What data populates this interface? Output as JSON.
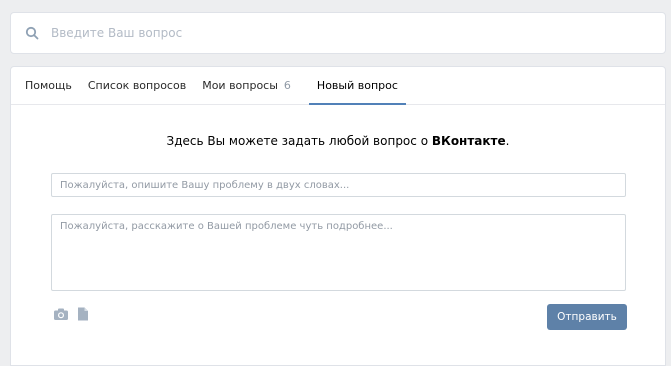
{
  "search": {
    "placeholder": "Введите Ваш вопрос",
    "icon": "search-icon"
  },
  "tabs": [
    {
      "label": "Помощь",
      "count": "",
      "active": false
    },
    {
      "label": "Список вопросов",
      "count": "",
      "active": false
    },
    {
      "label": "Мои вопросы",
      "count": "6",
      "active": false
    },
    {
      "label": "Новый вопрос",
      "count": "",
      "active": true
    }
  ],
  "intro": {
    "text": "Здесь Вы можете задать любой вопрос о ",
    "brand": "ВКонтакте",
    "suffix": "."
  },
  "form": {
    "subject_placeholder": "Пожалуйста, опишите Вашу проблему в двух словах...",
    "details_placeholder": "Пожалуйста, расскажите о Вашей проблеме чуть подробнее...",
    "attach_icons": [
      "camera-icon",
      "document-icon"
    ],
    "submit_label": "Отправить"
  },
  "colors": {
    "background": "#edeef0",
    "accent": "#5181b8",
    "button": "#5e81a8"
  }
}
